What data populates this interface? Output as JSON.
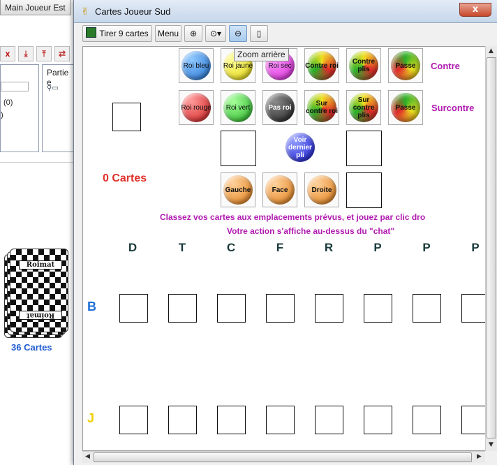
{
  "background_window": {
    "tab_label": "Main Joueur Est",
    "panel_title": "Partie e",
    "list_counts": [
      "(0)",
      ")"
    ],
    "deck_count": "36 Cartes",
    "deck_brand": "Roimat"
  },
  "window": {
    "title": "Cartes Joueur Sud",
    "close_label": "x"
  },
  "toolbar": {
    "deal_label": "Tirer 9 cartes",
    "menu_label": "Menu",
    "tooltip": "Zoom arrière"
  },
  "action_row1": {
    "buttons": [
      "Roi bleu",
      "Roi jaune",
      "Roi sec",
      "Contre roi",
      "Contre plis",
      "Passe"
    ],
    "heading": "Contre"
  },
  "action_row2": {
    "buttons": [
      "Roi rouge",
      "Roi vert",
      "Pas roi",
      "Sur contre roi",
      "Sur contre plis",
      "Passe"
    ],
    "heading": "Surcontre"
  },
  "last_trick_label": "Voir dernier pli",
  "card_count": "0 Cartes",
  "direction_buttons": [
    "Gauche",
    "Face",
    "Droite"
  ],
  "messages": {
    "line1": "Classez vos cartes aux emplacements prévus, et jouez par clic dro",
    "line2": "Votre action s'affiche au-dessus du \"chat\""
  },
  "columns": [
    "D",
    "T",
    "C",
    "F",
    "R",
    "P",
    "P",
    "P"
  ],
  "rows": [
    "B",
    "J"
  ],
  "colors": {
    "heading": "#b01ab0",
    "card_count": "#e0302a",
    "row_b": "#1f6fd6",
    "row_j": "#f0d000"
  }
}
